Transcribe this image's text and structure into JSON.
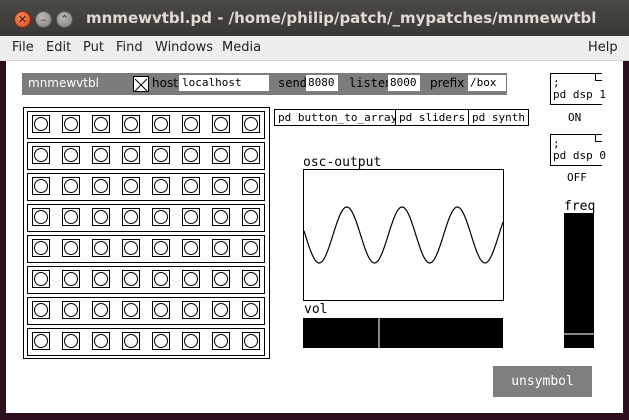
{
  "window": {
    "title": "mnmewvtbl.pd  - /home/philip/patch/_mypatches/mnmewvtbl"
  },
  "menu": [
    "File",
    "Edit",
    "Put",
    "Find",
    "Windows",
    "Media"
  ],
  "menu_help": "Help",
  "header": {
    "name": "mnmewvtbl",
    "host_label": "host",
    "host_value": "localhost",
    "send_label": "send",
    "send_value": "8080",
    "listen_label": "listen",
    "listen_value": "8000",
    "prefix_label": "prefix",
    "prefix_value": "/box",
    "toggle_state": "on"
  },
  "button_grid": {
    "rows": 8,
    "cols": 8
  },
  "objects": {
    "button_to_array": "pd button_to_array",
    "sliders": "pd sliders",
    "synth": "pd synth"
  },
  "scope": {
    "label": "osc-output"
  },
  "vol": {
    "label": "vol",
    "level": 0.38
  },
  "dsp": {
    "on_msg": ";\npd dsp 1",
    "on_label": "ON",
    "off_msg": ";\npd dsp 0",
    "off_label": "OFF"
  },
  "freq": {
    "label": "freq",
    "level": 0.1
  },
  "unsymbol_button": "unsymbol",
  "colors": {
    "titlebar": "#3c3b37",
    "canvas": "#ffffff",
    "header_bg": "#7c7c7c",
    "slider_bg": "#000000",
    "button_grey": "#7f7f7f"
  }
}
